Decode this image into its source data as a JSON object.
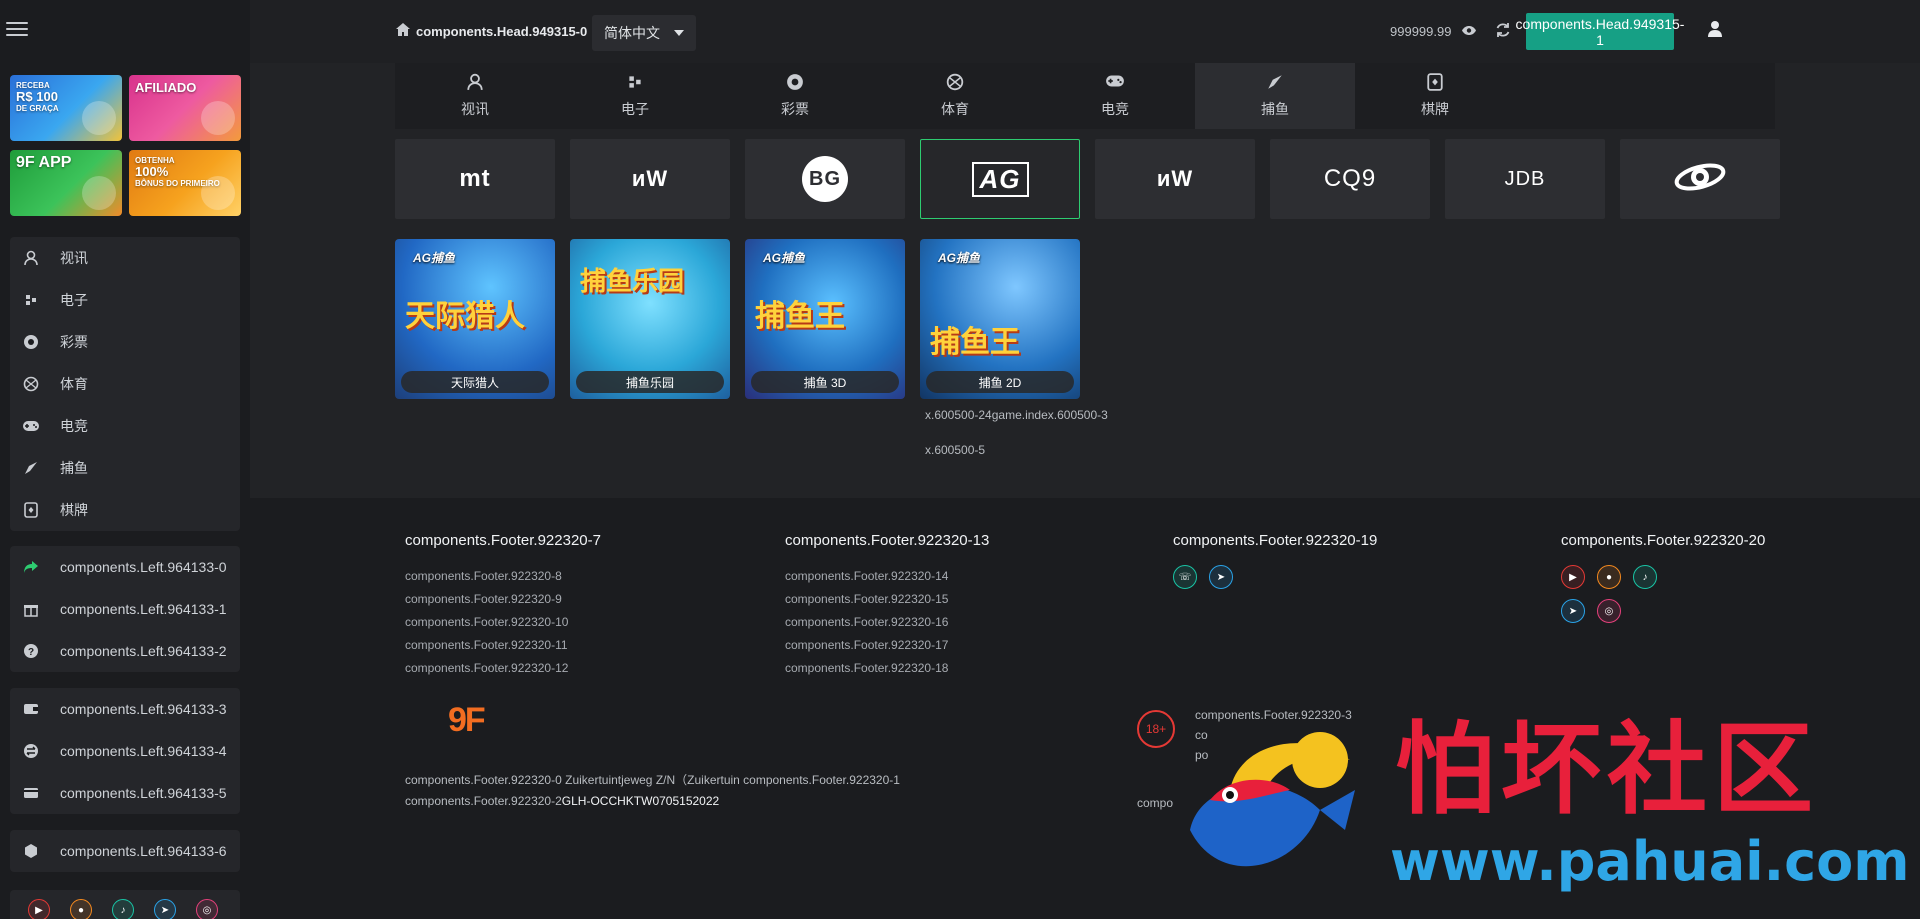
{
  "header": {
    "brand": "components.Head.949315-0",
    "language": "简体中文",
    "balance": "999999.99",
    "primary_button": "components.Head.949315-1"
  },
  "sidebar": {
    "promos": [
      {
        "line1": "RECEBA",
        "line2": "R$ 100",
        "line3": "DE GRAÇA"
      },
      {
        "line1": "",
        "line2": "AFILIADO",
        "line3": ""
      },
      {
        "line1": "",
        "line2": "9F APP",
        "line3": ""
      },
      {
        "line1": "OBTENHA",
        "line2": "100%",
        "line3": "BÔNUS DO PRIMEIRO"
      }
    ],
    "categories": [
      {
        "label": "视讯",
        "icon": "live-dealer-icon"
      },
      {
        "label": "电子",
        "icon": "slots-icon"
      },
      {
        "label": "彩票",
        "icon": "lottery-icon"
      },
      {
        "label": "体育",
        "icon": "sports-icon"
      },
      {
        "label": "电竞",
        "icon": "gamepad-icon"
      },
      {
        "label": "捕鱼",
        "icon": "fishing-icon"
      },
      {
        "label": "棋牌",
        "icon": "cards-icon"
      }
    ],
    "group2": [
      {
        "label": "components.Left.964133-0",
        "icon": "share-icon"
      },
      {
        "label": "components.Left.964133-1",
        "icon": "gift-icon"
      },
      {
        "label": "components.Left.964133-2",
        "icon": "help-icon"
      }
    ],
    "group3": [
      {
        "label": "components.Left.964133-3",
        "icon": "wallet-icon"
      },
      {
        "label": "components.Left.964133-4",
        "icon": "exchange-icon"
      },
      {
        "label": "components.Left.964133-5",
        "icon": "card-icon"
      }
    ],
    "group4": [
      {
        "label": "components.Left.964133-6",
        "icon": "cube-icon"
      }
    ]
  },
  "main": {
    "tabs": [
      {
        "label": "视讯",
        "icon": "live-dealer-icon",
        "active": false
      },
      {
        "label": "电子",
        "icon": "slots-icon",
        "active": false
      },
      {
        "label": "彩票",
        "icon": "lottery-icon",
        "active": false
      },
      {
        "label": "体育",
        "icon": "sports-icon",
        "active": false
      },
      {
        "label": "电竞",
        "icon": "gamepad-icon",
        "active": false
      },
      {
        "label": "捕鱼",
        "icon": "fishing-icon",
        "active": true
      },
      {
        "label": "棋牌",
        "icon": "cards-icon",
        "active": false
      }
    ],
    "providers": [
      {
        "logo": "mt",
        "active": false
      },
      {
        "logo": "ᴎW",
        "active": false
      },
      {
        "logo": "BG",
        "active": false
      },
      {
        "logo": "AG",
        "active": true
      },
      {
        "logo": "ᴎW",
        "active": false
      },
      {
        "logo": "CQ9",
        "active": false
      },
      {
        "logo": "JDB",
        "active": false
      },
      {
        "logo": "",
        "active": false
      }
    ],
    "games": [
      {
        "title": "天际猎人",
        "tag": "AG捕鱼",
        "art": "天际猎人"
      },
      {
        "title": "捕鱼乐园",
        "tag": "",
        "art": "捕鱼乐园"
      },
      {
        "title": "捕鱼 3D",
        "tag": "AG捕鱼",
        "art": "捕鱼王"
      },
      {
        "title": "捕鱼 2D",
        "tag": "AG捕鱼",
        "art": "捕鱼王"
      }
    ],
    "ref_line_1": "x.600500-24game.index.600500-3",
    "ref_line_2": "x.600500-5"
  },
  "footer": {
    "col1": {
      "title": "components.Footer.922320-7",
      "links": [
        "components.Footer.922320-8",
        "components.Footer.922320-9",
        "components.Footer.922320-10",
        "components.Footer.922320-11",
        "components.Footer.922320-12"
      ]
    },
    "col2": {
      "title": "components.Footer.922320-13",
      "links": [
        "components.Footer.922320-14",
        "components.Footer.922320-15",
        "components.Footer.922320-16",
        "components.Footer.922320-17",
        "components.Footer.922320-18"
      ]
    },
    "col3": {
      "title": "components.Footer.922320-19"
    },
    "col4": {
      "title": "components.Footer.922320-20"
    },
    "logo": "9F",
    "address_line1": "components.Footer.922320-0 Zuikertuintjeweg Z/N（Zuikertuin components.Footer.922320-1",
    "address_line2_prefix": "components.Footer.922320-2",
    "address_line2_code": "GLH-OCCHKTW0705152022",
    "age_badge": "18+",
    "text_3": "components.Footer.922320-3",
    "text_4": "co",
    "text_5": "po",
    "text_6": "compo"
  },
  "watermark": {
    "cn": "怕坏社区",
    "url": "www.pahuai.com"
  },
  "colors": {
    "accent": "#16a085",
    "active_border": "#2ecc71",
    "logo_orange": "#f26d21",
    "watermark_red": "#e8203b",
    "watermark_blue": "#2fa6e6"
  }
}
